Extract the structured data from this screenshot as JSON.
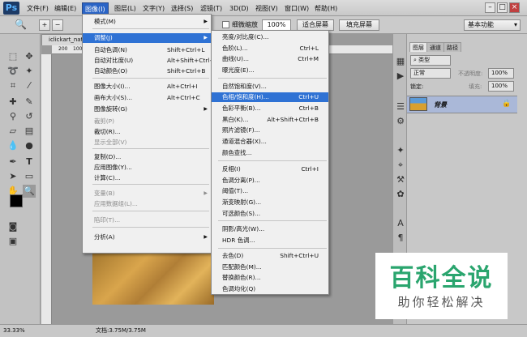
{
  "app": {
    "logo": "Ps"
  },
  "menubar": {
    "items": [
      "文件(F)",
      "编辑(E)",
      "图像(I)",
      "图层(L)",
      "文字(Y)",
      "选择(S)",
      "滤镜(T)",
      "3D(D)",
      "视图(V)",
      "窗口(W)",
      "帮助(H)"
    ],
    "active_index": 2
  },
  "window_buttons": [
    "–",
    "□",
    "×"
  ],
  "options": {
    "fine_zoom": "细微缩放",
    "zoom_value": "100%",
    "fit_screen": "适合屏幕",
    "fill_screen": "填充屏幕",
    "workspace": "基本功能"
  },
  "doc": {
    "tab_title": "iclickart_nat"
  },
  "ruler": {
    "h_labels": [
      "200",
      "100"
    ]
  },
  "image_menu": {
    "items": [
      {
        "label": "模式(M)",
        "shortcut": "",
        "submenu": true,
        "disabled": false
      },
      {
        "label": "调整(J)",
        "shortcut": "",
        "submenu": true,
        "disabled": false,
        "highlight": true
      },
      {
        "label": "自动色调(N)",
        "shortcut": "Shift+Ctrl+L",
        "disabled": false
      },
      {
        "label": "自动对比度(U)",
        "shortcut": "Alt+Shift+Ctrl+L",
        "disabled": false
      },
      {
        "label": "自动颜色(O)",
        "shortcut": "Shift+Ctrl+B",
        "disabled": false
      },
      {
        "label": "图像大小(I)...",
        "shortcut": "Alt+Ctrl+I",
        "disabled": false
      },
      {
        "label": "画布大小(S)...",
        "shortcut": "Alt+Ctrl+C",
        "disabled": false
      },
      {
        "label": "图像旋转(G)",
        "shortcut": "",
        "submenu": true,
        "disabled": false
      },
      {
        "label": "裁剪(P)",
        "shortcut": "",
        "disabled": true
      },
      {
        "label": "裁切(R)...",
        "shortcut": "",
        "disabled": false
      },
      {
        "label": "显示全部(V)",
        "shortcut": "",
        "disabled": true
      },
      {
        "label": "复制(D)...",
        "shortcut": "",
        "disabled": false
      },
      {
        "label": "应用图像(Y)...",
        "shortcut": "",
        "disabled": false
      },
      {
        "label": "计算(C)...",
        "shortcut": "",
        "disabled": false
      },
      {
        "label": "变量(B)",
        "shortcut": "",
        "submenu": true,
        "disabled": true
      },
      {
        "label": "应用数据组(L)...",
        "shortcut": "",
        "disabled": true
      },
      {
        "label": "陷印(T)...",
        "shortcut": "",
        "disabled": true
      },
      {
        "label": "分析(A)",
        "shortcut": "",
        "submenu": true,
        "disabled": false
      }
    ]
  },
  "adjust_menu": {
    "items": [
      {
        "label": "亮度/对比度(C)...",
        "shortcut": ""
      },
      {
        "label": "色阶(L)...",
        "shortcut": "Ctrl+L"
      },
      {
        "label": "曲线(U)...",
        "shortcut": "Ctrl+M"
      },
      {
        "label": "曝光度(E)...",
        "shortcut": ""
      },
      {
        "label": "自然饱和度(V)...",
        "shortcut": ""
      },
      {
        "label": "色相/饱和度(H)...",
        "shortcut": "Ctrl+U",
        "highlight": true
      },
      {
        "label": "色彩平衡(B)...",
        "shortcut": "Ctrl+B"
      },
      {
        "label": "黑白(K)...",
        "shortcut": "Alt+Shift+Ctrl+B"
      },
      {
        "label": "照片滤镜(F)...",
        "shortcut": ""
      },
      {
        "label": "通道混合器(X)...",
        "shortcut": ""
      },
      {
        "label": "颜色查找...",
        "shortcut": ""
      },
      {
        "label": "反相(I)",
        "shortcut": "Ctrl+I"
      },
      {
        "label": "色调分离(P)...",
        "shortcut": ""
      },
      {
        "label": "阈值(T)...",
        "shortcut": ""
      },
      {
        "label": "渐变映射(G)...",
        "shortcut": ""
      },
      {
        "label": "可选颜色(S)...",
        "shortcut": ""
      },
      {
        "label": "阴影/高光(W)...",
        "shortcut": ""
      },
      {
        "label": "HDR 色调...",
        "shortcut": ""
      },
      {
        "label": "去色(D)",
        "shortcut": "Shift+Ctrl+U"
      },
      {
        "label": "匹配颜色(M)...",
        "shortcut": ""
      },
      {
        "label": "替换颜色(R)...",
        "shortcut": ""
      },
      {
        "label": "色调均化(Q)",
        "shortcut": ""
      }
    ]
  },
  "layers_panel": {
    "tabs": [
      "图层",
      "通道",
      "路径"
    ],
    "kind": "类型",
    "blend": "正常",
    "opacity_label": "不透明度:",
    "opacity": "100%",
    "lock_label": "锁定:",
    "fill_label": "填充:",
    "fill": "100%",
    "layer_name": "背景"
  },
  "status": {
    "zoom": "33.33%",
    "doc_info": "文档:3.75M/3.75M"
  },
  "watermark": {
    "title": "百科全说",
    "subtitle": "助你轻松解决"
  }
}
